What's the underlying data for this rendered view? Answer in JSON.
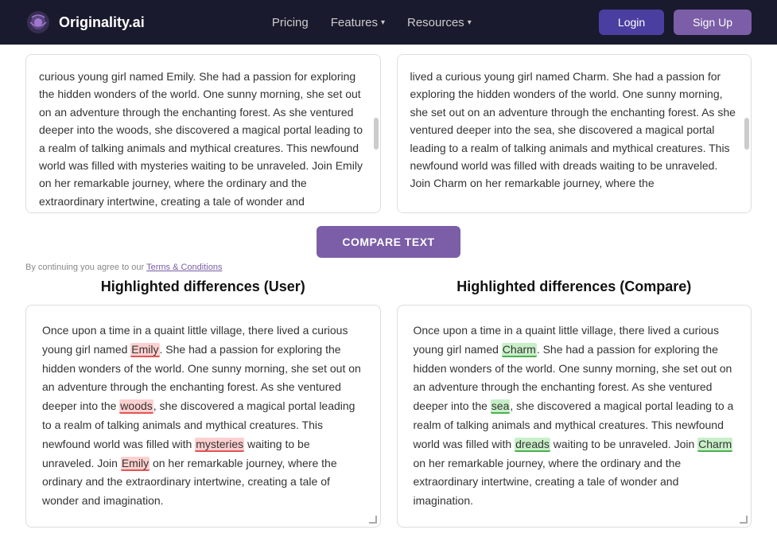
{
  "navbar": {
    "logo_text": "Originality.ai",
    "links": [
      {
        "label": "Pricing",
        "has_chevron": false
      },
      {
        "label": "Features",
        "has_chevron": true
      },
      {
        "label": "Resources",
        "has_chevron": true
      }
    ],
    "login_label": "Login",
    "signup_label": "Sign Up"
  },
  "compare": {
    "button_label": "COMPARE TEXT"
  },
  "terms": {
    "prefix": "By continuing you agree to our ",
    "link_text": "Terms & Conditions"
  },
  "diff_user": {
    "title": "Highlighted differences (User)"
  },
  "diff_compare": {
    "title": "Highlighted differences (Compare)"
  }
}
